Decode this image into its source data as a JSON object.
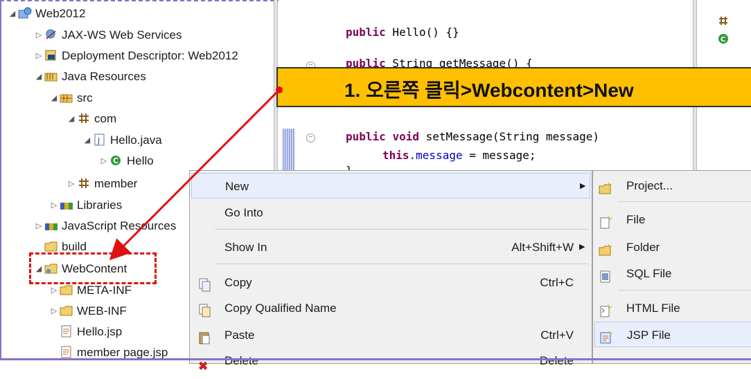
{
  "tree": {
    "items": [
      {
        "label": "Web2012",
        "twisty": "◢",
        "icon": "web-project-icon"
      },
      {
        "label": "JAX-WS Web Services",
        "twisty": "▷",
        "icon": "web-services-icon"
      },
      {
        "label": "Deployment Descriptor: Web2012",
        "twisty": "▷",
        "icon": "deployment-descriptor-icon"
      },
      {
        "label": "Java Resources",
        "twisty": "◢",
        "icon": "java-resources-icon"
      },
      {
        "label": "src",
        "twisty": "◢",
        "icon": "source-folder-icon"
      },
      {
        "label": "com",
        "twisty": "◢",
        "icon": "package-icon"
      },
      {
        "label": "Hello.java",
        "twisty": "◢",
        "icon": "java-file-icon"
      },
      {
        "label": "Hello",
        "twisty": "▷",
        "icon": "class-icon"
      },
      {
        "label": "member",
        "twisty": "▷",
        "icon": "package-icon"
      },
      {
        "label": "Libraries",
        "twisty": "▷",
        "icon": "libraries-icon"
      },
      {
        "label": "JavaScript Resources",
        "twisty": "▷",
        "icon": "libraries-icon"
      },
      {
        "label": "build",
        "twisty": "",
        "icon": "folder-icon"
      },
      {
        "label": "WebContent",
        "twisty": "◢",
        "icon": "web-folder-icon"
      },
      {
        "label": "META-INF",
        "twisty": "▷",
        "icon": "folder-icon"
      },
      {
        "label": "WEB-INF",
        "twisty": "▷",
        "icon": "folder-icon"
      },
      {
        "label": "Hello.jsp",
        "twisty": "",
        "icon": "jsp-file-icon"
      },
      {
        "label": "member page.jsp",
        "twisty": "",
        "icon": "jsp-file-icon"
      }
    ]
  },
  "editor": {
    "line1": "public Hello() {}",
    "line2": "public String getMessage() {",
    "line3": "public void setMessage(String message)",
    "line4_kw": "this",
    "line4_rest": ".message = message;",
    "line5": "}"
  },
  "callout": {
    "text": "1. 오른쪽 클릭>Webcontent>New"
  },
  "context_menu": {
    "items": [
      {
        "label": "New",
        "shortcut": "",
        "submenu": true
      },
      {
        "label": "Go Into",
        "shortcut": ""
      },
      {
        "label": "Show In",
        "shortcut": "Alt+Shift+W",
        "submenu": true
      },
      {
        "label": "Copy",
        "shortcut": "Ctrl+C",
        "icon": "copy-icon"
      },
      {
        "label": "Copy Qualified Name",
        "shortcut": "",
        "icon": "copy-qualified-icon"
      },
      {
        "label": "Paste",
        "shortcut": "Ctrl+V",
        "icon": "paste-icon"
      },
      {
        "label": "Delete",
        "shortcut": "Delete",
        "icon": "delete-icon"
      }
    ]
  },
  "submenu": {
    "items": [
      {
        "label": "Project...",
        "icon": "new-project-icon"
      },
      {
        "label": "File",
        "icon": "new-file-icon"
      },
      {
        "label": "Folder",
        "icon": "new-folder-icon"
      },
      {
        "label": "SQL File",
        "icon": "sql-file-icon"
      },
      {
        "label": "HTML File",
        "icon": "html-file-icon"
      },
      {
        "label": "JSP File",
        "icon": "jsp-file-icon"
      }
    ]
  },
  "colors": {
    "callout": "#ffc000",
    "arrow": "#e01010",
    "highlight": "#e8eefb"
  }
}
